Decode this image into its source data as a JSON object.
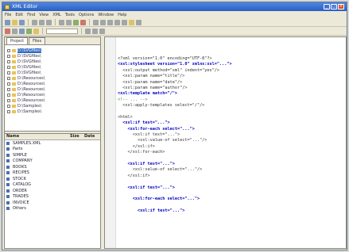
{
  "window": {
    "title": "XML Editor"
  },
  "menus": [
    "File",
    "Edit",
    "Find",
    "View",
    "XML",
    "Tools",
    "Options",
    "Window",
    "Help"
  ],
  "left_tabs": [
    "Project",
    "Files"
  ],
  "tree_items": [
    "D:\\SVGfiles\\",
    "D:\\SVGfiles\\",
    "D:\\SVGfiles\\",
    "D:\\SVGfiles\\",
    "D:\\SVGfiles\\",
    "D:\\Resources\\",
    "D:\\Resources\\",
    "D:\\Resources\\",
    "D:\\Resources\\",
    "D:\\Resources\\",
    "D:\\Samples\\",
    "D:\\Samples\\"
  ],
  "file_columns": {
    "name": "Name",
    "size": "Size",
    "date": "Date"
  },
  "files": [
    {
      "name": "SAMPLES.XML",
      "size": "",
      "date": ""
    },
    {
      "name": "Parts",
      "size": "",
      "date": ""
    },
    {
      "name": "SIMPLE",
      "size": "",
      "date": ""
    },
    {
      "name": "COMPANY",
      "size": "",
      "date": ""
    },
    {
      "name": "BOOKS",
      "size": "",
      "date": ""
    },
    {
      "name": "RECIPES",
      "size": "",
      "date": ""
    },
    {
      "name": "STOCK",
      "size": "",
      "date": ""
    },
    {
      "name": "CATALOG",
      "size": "",
      "date": ""
    },
    {
      "name": "ORDER",
      "size": "",
      "date": ""
    },
    {
      "name": "TRADES",
      "size": "",
      "date": ""
    },
    {
      "name": "INVOICE",
      "size": "",
      "date": ""
    },
    {
      "name": "Others",
      "size": "",
      "date": ""
    }
  ],
  "code_lines": [
    {
      "t": "<?xml version=\"1.0\" encoding=\"UTF-8\"?>",
      "c": ""
    },
    {
      "t": "<xsl:stylesheet version=\"1.0\" xmlns:xsl=\"...\">",
      "c": "kw"
    },
    {
      "t": "  <xsl:output method=\"xml\" indent=\"yes\"/>",
      "c": ""
    },
    {
      "t": "  <xsl:param name=\"title\"/>",
      "c": ""
    },
    {
      "t": "  <xsl:param name=\"date\"/>",
      "c": ""
    },
    {
      "t": "  <xsl:param name=\"author\"/>",
      "c": ""
    },
    {
      "t": "<xsl:template match=\"/\">",
      "c": "kw"
    },
    {
      "t": "<!-- ... -->",
      "c": "cm"
    },
    {
      "t": "  <xsl:apply-templates select=\"/\"/>",
      "c": ""
    },
    {
      "t": "",
      "c": ""
    },
    {
      "t": "<html>",
      "c": ""
    },
    {
      "t": "  <xsl:if test=\"...\">",
      "c": "kw"
    },
    {
      "t": "    <xsl:for-each select=\"...\">",
      "c": "kw"
    },
    {
      "t": "      <xsl:if test=\"...\">",
      "c": ""
    },
    {
      "t": "        <xsl:value-of select=\"...\"/>",
      "c": ""
    },
    {
      "t": "      </xsl:if>",
      "c": ""
    },
    {
      "t": "    </xsl:for-each>",
      "c": ""
    },
    {
      "t": "",
      "c": ""
    },
    {
      "t": "    <xsl:if test=\"...\">",
      "c": "kw"
    },
    {
      "t": "      <xsl:value-of select=\"...\"/>",
      "c": ""
    },
    {
      "t": "    </xsl:if>",
      "c": ""
    },
    {
      "t": "",
      "c": ""
    },
    {
      "t": "    <xsl:if test=\"...\">",
      "c": "kw"
    },
    {
      "t": "",
      "c": ""
    },
    {
      "t": "      <xsl:for-each select=\"...\">",
      "c": "kw"
    },
    {
      "t": "",
      "c": ""
    },
    {
      "t": "        <xsl:if test=\"...\">",
      "c": "kw"
    }
  ]
}
